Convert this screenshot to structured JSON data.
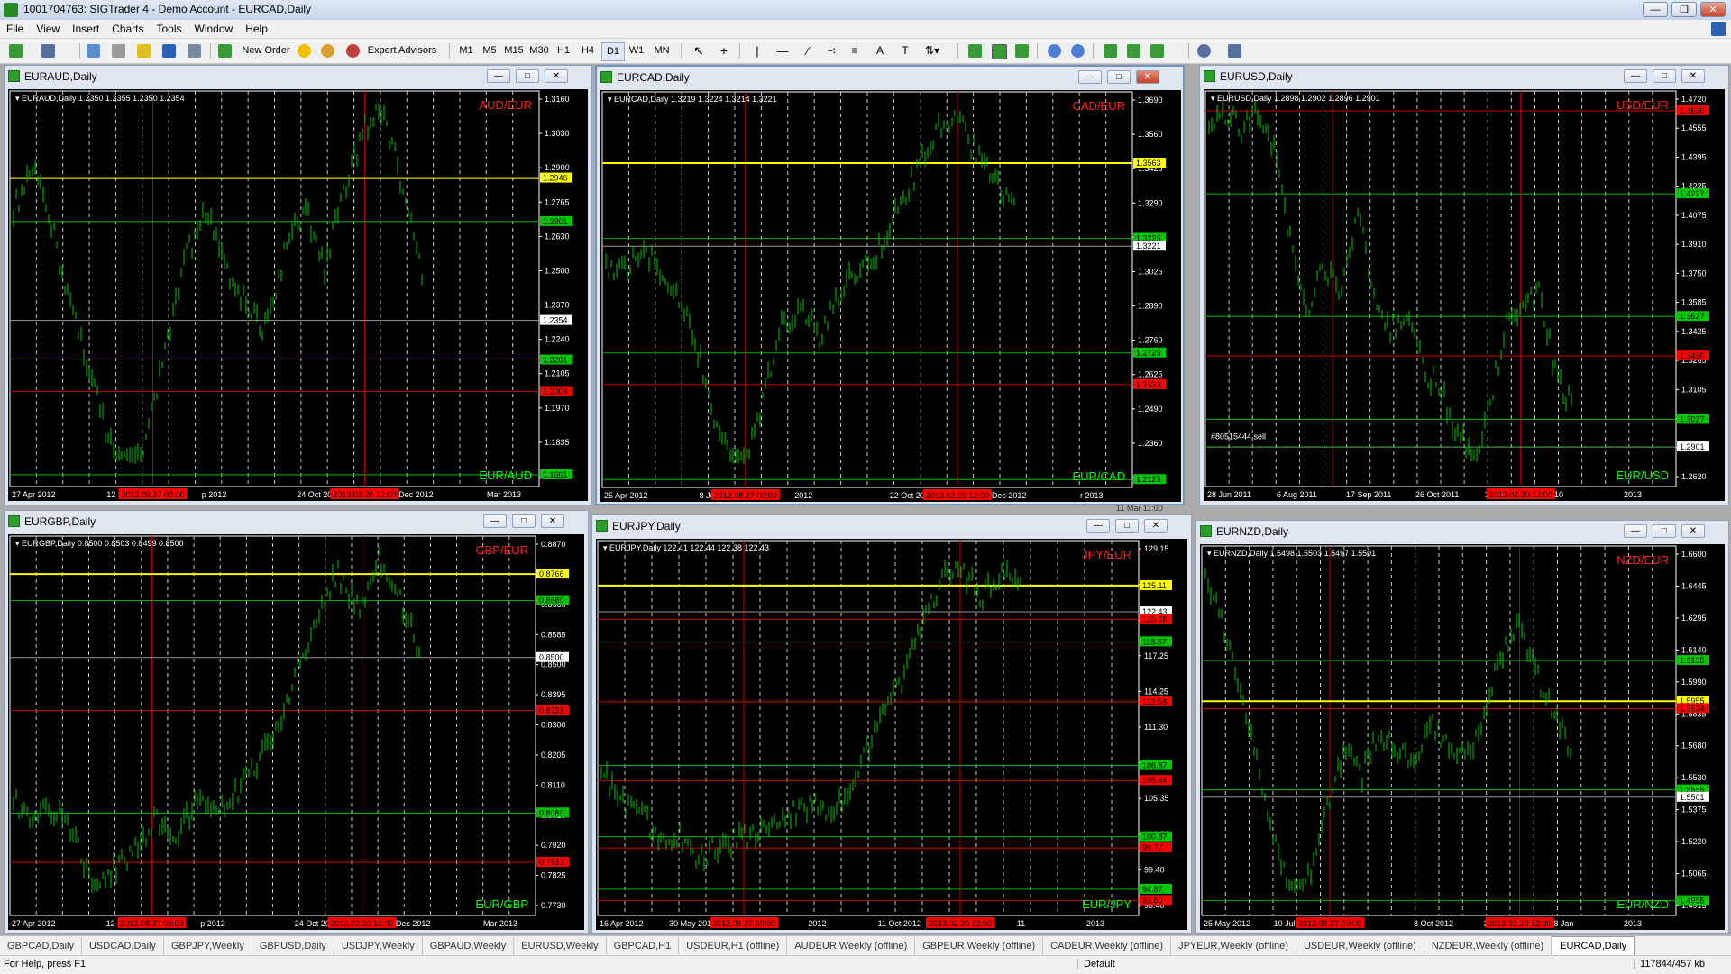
{
  "window": {
    "title": "1001704763: SIGTrader 4 - Demo Account - EURCAD,Daily"
  },
  "menu": [
    "File",
    "View",
    "Insert",
    "Charts",
    "Tools",
    "Window",
    "Help"
  ],
  "toolbar": {
    "new_order": "New Order",
    "expert_advisors": "Expert Advisors",
    "timeframes": [
      "M1",
      "M5",
      "M15",
      "M30",
      "H1",
      "H4",
      "D1",
      "W1",
      "MN"
    ],
    "selected_timeframe": "D1"
  },
  "charts": [
    {
      "title": "EURAUD,Daily",
      "info": "EURAUD,Daily  1.2350 1.2355 1.2350 1.2354",
      "label_top": "AUD/EUR",
      "label_bottom": "EUR/AUD",
      "active": false,
      "prices": [
        "1.3160",
        "1.3030",
        "1.2900",
        "1.2765",
        "1.2630",
        "1.2500",
        "1.2370",
        "1.2240",
        "1.2105",
        "1.1970",
        "1.1835",
        "1.1700"
      ],
      "markers": [
        {
          "text": "1.2946",
          "kind": "yellow"
        },
        {
          "text": "1.2801",
          "kind": "green"
        },
        {
          "text": "1.2354",
          "kind": "white"
        },
        {
          "text": "1.2201",
          "kind": "green"
        },
        {
          "text": "1.2004",
          "kind": "red"
        },
        {
          "text": "1.1601",
          "kind": "green"
        }
      ],
      "dates": [
        "27 Apr 2012",
        "12 Jun 2012",
        "p 2012",
        "24 Oct 2012",
        "7 Dec 2012",
        "Mar 2013"
      ],
      "date_badges": [
        "2012.08.27 00:00",
        "2013.02.20 12:00"
      ],
      "note": ""
    },
    {
      "title": "EURCAD,Daily",
      "info": "EURCAD,Daily  1.3219 1.3224 1.3214 1.3221",
      "label_top": "CAD/EUR",
      "label_bottom": "EUR/CAD",
      "active": true,
      "prices": [
        "1.3690",
        "1.3560",
        "1.3425",
        "1.3290",
        "1.3155",
        "1.3025",
        "1.2890",
        "1.2760",
        "1.2625",
        "1.2490",
        "1.2360",
        "1.2225"
      ],
      "markers": [
        {
          "text": "1.3563",
          "kind": "yellow"
        },
        {
          "text": "1.3225",
          "kind": "green"
        },
        {
          "text": "1.3221",
          "kind": "white"
        },
        {
          "text": "1.2725",
          "kind": "green"
        },
        {
          "text": "1.2533",
          "kind": "red"
        },
        {
          "text": "1.2125",
          "kind": "green"
        }
      ],
      "dates": [
        "25 Apr 2012",
        "8 Jun 2012",
        "2012",
        "22 Oct 2012",
        "5 Dec 2012",
        "r 2013"
      ],
      "date_badges": [
        "2012.08.27 00:00",
        "2013.02.20 12:00"
      ],
      "note": ""
    },
    {
      "title": "EURUSD,Daily",
      "info": "EURUSD,Daily  1.2898 1.2902 1.2896 1.2901",
      "label_top": "USD/EUR",
      "label_bottom": "EUR/USD",
      "active": false,
      "prices": [
        "1.4720",
        "1.4555",
        "1.4395",
        "1.4225",
        "1.4075",
        "1.3910",
        "1.3750",
        "1.3585",
        "1.3425",
        "1.3265",
        "1.3105",
        "1.2945",
        "1.2780",
        "1.2620"
      ],
      "markers": [
        {
          "text": "1.4630",
          "kind": "red"
        },
        {
          "text": "1.4227",
          "kind": "green"
        },
        {
          "text": "1.3627",
          "kind": "green"
        },
        {
          "text": "1.3460",
          "kind": "red"
        },
        {
          "text": "1.3027",
          "kind": "green"
        },
        {
          "text": "1.2901",
          "kind": "white"
        }
      ],
      "dates": [
        "28 Jun 2011",
        "6 Aug 2011",
        "17 Sep 2011",
        "26 Oct 2011",
        "3 Dec 2011",
        "10",
        "2013"
      ],
      "date_badges": [
        "2013.02.20 12:00"
      ],
      "note": "#80515444 sell"
    },
    {
      "title": "EURGBP,Daily",
      "info": "EURGBP,Daily  0.8500 0.8503 0.8499 0.8500",
      "label_top": "GBP/EUR",
      "label_bottom": "EUR/GBP",
      "active": false,
      "prices": [
        "0.8870",
        "0.8765",
        "0.8655",
        "0.8585",
        "0.8500",
        "0.8395",
        "0.8300",
        "0.8205",
        "0.8110",
        "0.8015",
        "0.7920",
        "0.7825",
        "0.7730"
      ],
      "markers": [
        {
          "text": "0.8766",
          "kind": "yellow"
        },
        {
          "text": "0.8680",
          "kind": "green"
        },
        {
          "text": "0.8500",
          "kind": "white"
        },
        {
          "text": "0.8339",
          "kind": "red"
        },
        {
          "text": "0.8080",
          "kind": "green"
        },
        {
          "text": "0.7933",
          "kind": "red"
        }
      ],
      "dates": [
        "27 Apr 2012",
        "12 Jun 2012",
        "p 2012",
        "24 Oct 2012",
        "7 Dec 2012",
        "Mar 2013"
      ],
      "date_badges": [
        "2012.08.27 00:00",
        "2013.02.20 12:00"
      ],
      "note": ""
    },
    {
      "title": "EURJPY,Daily",
      "info": "EURJPY,Daily  122.41 122.44 122.38 122.43",
      "label_top": "JPY/EUR",
      "label_bottom": "EUR/JPY",
      "active": false,
      "prices": [
        "129.15",
        "126.20",
        "123.20",
        "117.25",
        "114.25",
        "111.30",
        "108.30",
        "105.35",
        "102.35",
        "99.40",
        "96.40"
      ],
      "markers": [
        {
          "text": "125.11",
          "kind": "yellow"
        },
        {
          "text": "122.43",
          "kind": "white"
        },
        {
          "text": "120.78",
          "kind": "red"
        },
        {
          "text": "118.87",
          "kind": "green"
        },
        {
          "text": "112.58",
          "kind": "red"
        },
        {
          "text": "106.87",
          "kind": "green"
        },
        {
          "text": "105.44",
          "kind": "red"
        },
        {
          "text": "100.87",
          "kind": "green"
        },
        {
          "text": "99.77",
          "kind": "red"
        },
        {
          "text": "94.87",
          "kind": "green"
        },
        {
          "text": "93.80",
          "kind": "red"
        }
      ],
      "dates": [
        "16 Apr 2012",
        "30 May 2012",
        "13 Ju",
        "2012",
        "11 Oct 2012",
        "26 Nov 2012",
        "11",
        "2013"
      ],
      "date_badges": [
        "2012.08.27 00:00",
        "2013.02.20 12:00"
      ],
      "note": ""
    },
    {
      "title": "EURNZD,Daily",
      "info": "EURNZD,Daily  1.5498 1.5503 1.5497 1.5501",
      "label_top": "NZD/EUR",
      "label_bottom": "EUR/NZD",
      "active": false,
      "prices": [
        "1.6600",
        "1.6445",
        "1.6295",
        "1.6140",
        "1.5990",
        "1.5835",
        "1.5680",
        "1.5530",
        "1.5375",
        "1.5220",
        "1.5065",
        "1.4915"
      ],
      "markers": [
        {
          "text": "1.6155",
          "kind": "green"
        },
        {
          "text": "1.5955",
          "kind": "yellow"
        },
        {
          "text": "1.5924",
          "kind": "red"
        },
        {
          "text": "1.5555",
          "kind": "green"
        },
        {
          "text": "1.5501",
          "kind": "white"
        },
        {
          "text": "1.4955",
          "kind": "green"
        }
      ],
      "dates": [
        "25 May 2012",
        "10 Jul",
        "2",
        "8 Oct 2012",
        "21 Nov 2012",
        "8 Jan",
        "2013"
      ],
      "date_badges": [
        "2012.08.27 00:00",
        "2013.02.20 12:00"
      ],
      "note": ""
    }
  ],
  "extra": {
    "stray_date": "11 Mar 11:00"
  },
  "tabs": [
    "GBPCAD,Daily",
    "USDCAD,Daily",
    "GBPJPY,Weekly",
    "GBPUSD,Daily",
    "USDJPY,Weekly",
    "GBPAUD,Weekly",
    "EURUSD,Weekly",
    "GBPCAD,H1",
    "USDEUR,H1 (offline)",
    "AUDEUR,Weekly (offline)",
    "GBPEUR,Weekly (offline)",
    "CADEUR,Weekly (offline)",
    "JPYEUR,Weekly (offline)",
    "USDEUR,Weekly (offline)",
    "NZDEUR,Weekly (offline)",
    "EURCAD,Daily"
  ],
  "selected_tab": "EURCAD,Daily",
  "status": {
    "help": "For Help, press F1",
    "profile": "Default",
    "traffic": "117844/457 kb"
  },
  "colors": {
    "candle": "#00c800",
    "yellow": "#ffff00",
    "green_line": "#00b400",
    "red_line": "#c80000",
    "label_red": "#ff2020",
    "label_green": "#00ff00"
  }
}
